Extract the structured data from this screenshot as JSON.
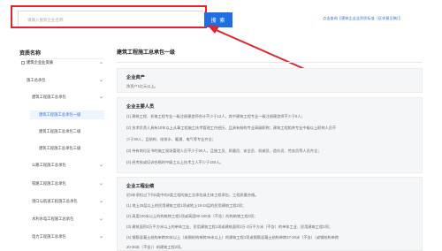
{
  "search": {
    "placeholder": "请输入搜索企业名称",
    "button_label": "搜 索",
    "top_link": "点击查询【建筑企业业资质标准（征求意见稿）】"
  },
  "sidebar": {
    "title": "资质名称",
    "items": [
      {
        "label": "建筑企业业资质",
        "level": 0
      },
      {
        "label": "施工总承包",
        "level": 1
      },
      {
        "label": "建筑工程施工总承包",
        "level": 2
      },
      {
        "label": "建筑工程施工总承包一级",
        "level": 3,
        "active": true
      },
      {
        "label": "建筑工程施工总承包二级",
        "level": 3
      },
      {
        "label": "建筑工程施工总承包三级",
        "level": 3
      },
      {
        "label": "公路工程施工总承包",
        "level": 2
      },
      {
        "label": "铁路工程施工总承包",
        "level": 2
      },
      {
        "label": "港口与航道工程施工总承包",
        "level": 2
      },
      {
        "label": "水利水电工程施工总承包",
        "level": 2
      },
      {
        "label": "电力工程施工总承包",
        "level": 2
      }
    ]
  },
  "main": {
    "title": "建筑工程施工总承包一级",
    "sections": [
      {
        "title": "企业资产",
        "lines": [
          "净资产1亿元以上。"
        ]
      },
      {
        "title": "企业主要人员",
        "lines": [
          "(1) 建筑工程、机电工程专业一级注册建造师合计不少于12人，其中建筑工程专业一级注册建造师不少于9人；",
          "(2) 技术负责人具有10年以上从事工程施工技术管理工作经历，且具有结构专业高级职称；建筑工程相关专业中级以上职称人员不",
          "少于30人，且结构、给排水、暖通、电气等专业齐全；",
          "(3) 持有岗位证书的施工现场管理人员不少于50人，且施工员、质量员、安全员、机械员、造价员、劳务员等人员齐全；",
          "(4) 经考核或培训合格的中级工以上技术工人不少于150人。"
        ]
      },
      {
        "title": "企业工程业绩",
        "lines": [
          "近5年承担过下列4类中的2类工程的施工总承包或主体工程承包，工程质量合格。",
          "(1) 地上25层以上的民用建筑工程1项或地上18-24层的民用建筑工程2项；",
          "(2) 高度100米以上的构筑物工程1项或高度80-100米（不含）的构筑物工程2项；",
          "(3) 建筑面积3万平方米以上的单体工业、民用建筑工程1项或建筑面积2万-3万平方米（不含）的单体工业、民用建筑工程2项；",
          "(4) 钢筋混凝土结构单跨30米以上（或钢结构单跨36米以上）的建筑工程1项或钢筋混凝土结构单跨27-30米（不含）（或钢结构单跨",
          "30-36米（不含））的建筑工程2项。"
        ]
      }
    ]
  },
  "colors": {
    "accent": "#1f6fe0",
    "highlight": "#e2242b",
    "link": "#2f74d8"
  }
}
